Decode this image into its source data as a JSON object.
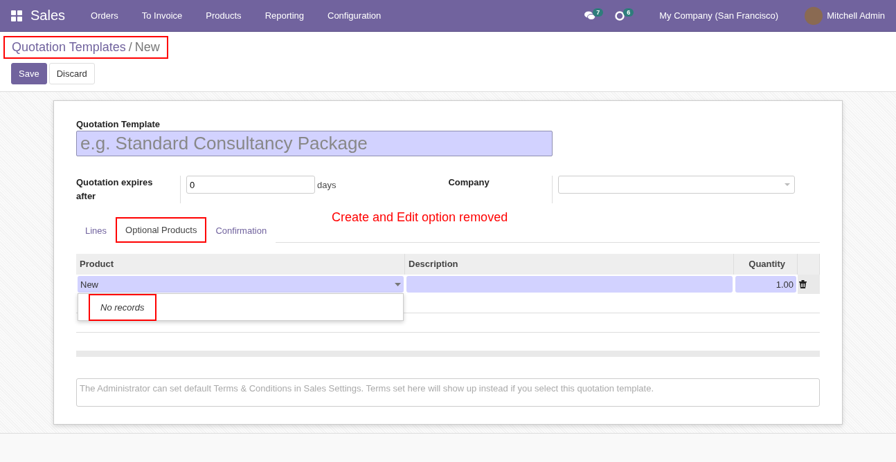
{
  "navbar": {
    "app": "Sales",
    "menu": [
      "Orders",
      "To Invoice",
      "Products",
      "Reporting",
      "Configuration"
    ],
    "messages_badge": "7",
    "activities_badge": "6",
    "company": "My Company (San Francisco)",
    "user": "Mitchell Admin"
  },
  "breadcrumb": {
    "parent": "Quotation Templates",
    "separator": "/",
    "current": "New",
    "highlighted": true
  },
  "buttons": [
    {
      "label": "Save",
      "kind": "primary"
    },
    {
      "label": "Discard",
      "kind": "secondary"
    }
  ],
  "form": {
    "name_label": "Quotation Template",
    "name_placeholder": "e.g. Standard Consultancy Package",
    "expires_label": "Quotation expires after",
    "expires_value": "0",
    "expires_unit": "days",
    "company_label": "Company"
  },
  "annotation": "Create and Edit option removed",
  "tabs": [
    {
      "label": "Lines",
      "selected": false,
      "highlighted": false
    },
    {
      "label": "Optional Products",
      "selected": true,
      "highlighted": true
    },
    {
      "label": "Confirmation",
      "selected": false,
      "highlighted": false
    }
  ],
  "table": {
    "columns": [
      "Product",
      "Description",
      "Quantity"
    ],
    "row": {
      "product": "New",
      "quantity": "1.00"
    },
    "dropdown": {
      "text": "No records",
      "highlighted": true
    }
  },
  "note_placeholder": "The Administrator can set default Terms & Conditions in Sales Settings. Terms set here will show up instead if you select this quotation template."
}
